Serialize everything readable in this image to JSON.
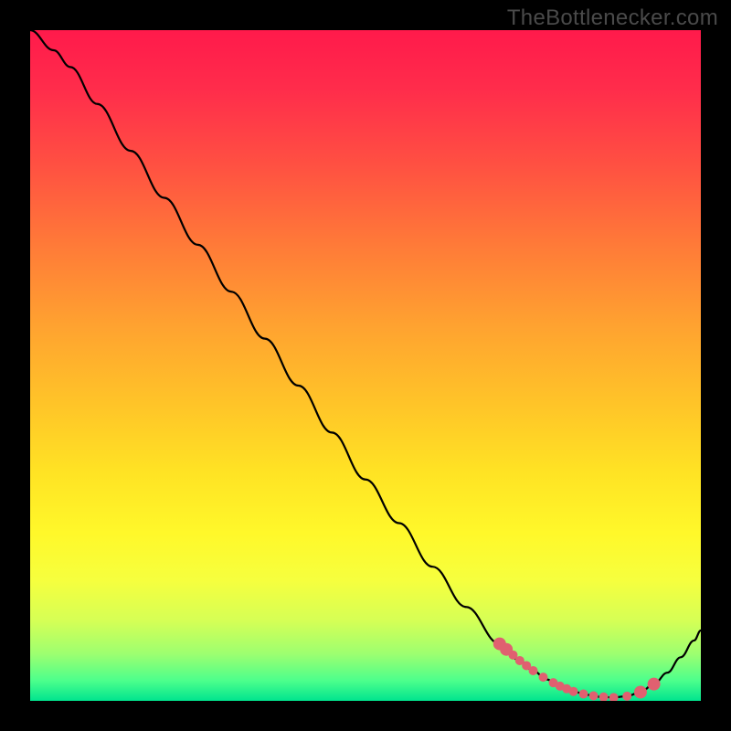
{
  "watermark": "TheBottlenecker.com",
  "colors": {
    "background": "#000000",
    "curve_stroke": "#000000",
    "marker_fill": "#e06070"
  },
  "chart_data": {
    "type": "line",
    "title": "",
    "xlabel": "",
    "ylabel": "",
    "xlim": [
      0,
      100
    ],
    "ylim": [
      0,
      100
    ],
    "x": [
      0,
      3.5,
      6,
      10,
      15,
      20,
      25,
      30,
      35,
      40,
      45,
      50,
      55,
      60,
      65,
      70,
      73,
      75,
      77,
      79,
      81,
      83,
      85,
      87,
      89,
      91,
      93,
      95,
      97,
      99,
      100
    ],
    "values": [
      100,
      97,
      94.5,
      89,
      82,
      75,
      68,
      61,
      54,
      47,
      40,
      33,
      26.5,
      20,
      14,
      8.5,
      6,
      4.5,
      3.2,
      2.2,
      1.4,
      0.9,
      0.6,
      0.5,
      0.7,
      1.3,
      2.5,
      4.2,
      6.5,
      9,
      10.5
    ],
    "markers": {
      "note": "approximate x positions of highlighted red points along the curve near the trough",
      "x": [
        70,
        71,
        72,
        73,
        74,
        75,
        76.5,
        78,
        79,
        80,
        81,
        82.5,
        84,
        85.5,
        87,
        89,
        91,
        93
      ],
      "radius_px_small": 5,
      "radius_px_large": 7
    }
  }
}
